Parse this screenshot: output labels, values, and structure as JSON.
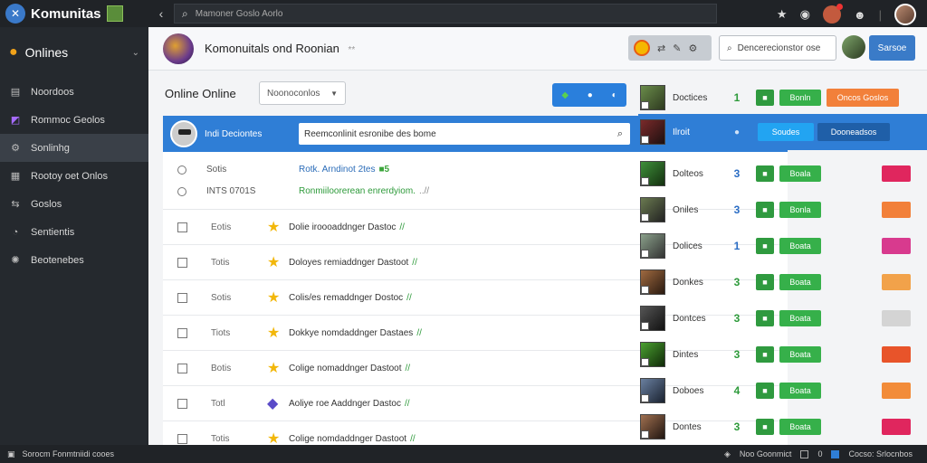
{
  "app": {
    "name": "Komunitas",
    "search_placeholder": "Mamoner Goslo Aorlo"
  },
  "sidebar": {
    "header": "Onlines",
    "items": [
      {
        "icon": "list-icon",
        "label": "Noordoos"
      },
      {
        "icon": "puzzle-icon",
        "label": "Rommoc Geolos"
      },
      {
        "icon": "gear-icon",
        "label": "Sonlinhg"
      },
      {
        "icon": "table-icon",
        "label": "Rootoy oet Onlos"
      },
      {
        "icon": "share-icon",
        "label": "Goslos"
      },
      {
        "icon": "chat-icon",
        "label": "Sentientis"
      },
      {
        "icon": "settings-icon",
        "label": "Beotenebes"
      }
    ]
  },
  "header": {
    "title": "Komonuitals ond Roonian",
    "subtitle": "**",
    "search_placeholder": "Dencerecionstor ose",
    "button": "Sarsoe"
  },
  "section": {
    "title": "Online Online",
    "filter": "Noonoconlos",
    "toggle_icons": [
      "◆",
      "●",
      "◐"
    ]
  },
  "table": {
    "header_label": "Indi Deciontes",
    "header_search": "Reemconlinit esronibe des bome",
    "radio_rows": [
      {
        "label": "Sotis",
        "text": "Rotk. Arndinot 2tes",
        "badge": "■5",
        "color": "blue"
      },
      {
        "label": "INTS 0701S",
        "text": "Ronmiiloorerean enrerdyiom.",
        "badge": "..//",
        "color": "green"
      }
    ],
    "rows": [
      {
        "label": "Eotis",
        "text": "Dolie iroooaddnger Dastoc",
        "mark": "//",
        "icon": "star-icon"
      },
      {
        "label": "Totis",
        "text": "Doloyes remiaddnger Dastoot",
        "mark": "//",
        "icon": "star-icon"
      },
      {
        "label": "Sotis",
        "text": "Colis/es remaddnger Dostoc",
        "mark": "//",
        "icon": "star-icon"
      },
      {
        "label": "Tiots",
        "text": "Dokkye nomdaddnger Dastaes",
        "mark": "//",
        "icon": "star-icon"
      },
      {
        "label": "Botis",
        "text": "Colige nomaddnger Dastoot",
        "mark": "//",
        "icon": "star-icon"
      },
      {
        "label": "Totl",
        "text": "Aoliye roe Aaddnger Dastoc",
        "mark": "//",
        "icon": "gem-icon"
      },
      {
        "label": "Totis",
        "text": "Colige nomdaddnger Dastoot",
        "mark": "//",
        "icon": "star-icon"
      }
    ]
  },
  "right_panel": {
    "top": {
      "label": "Doctices",
      "num": "1",
      "badge": "■",
      "btn": "Bonln",
      "btn2": "Oncos Goslos"
    },
    "highlight": {
      "label": "Ilroit",
      "btn1": "Soudes",
      "btn2": "Dooneadsos"
    },
    "rows": [
      {
        "label": "Dolteos",
        "num": "3",
        "badge": "■",
        "btn": "Boala",
        "color": "#e0265e"
      },
      {
        "label": "Oniles",
        "num": "3",
        "badge": "■",
        "btn": "Bonla",
        "color": "#f2803a"
      },
      {
        "label": "Dolices",
        "num": "1",
        "badge": "■",
        "btn": "Boata",
        "color": "#d83a8e"
      },
      {
        "label": "Donkes",
        "num": "3",
        "badge": "■",
        "btn": "Boata",
        "color": "#f2a24a"
      },
      {
        "label": "Dontces",
        "num": "3",
        "badge": "■",
        "btn": "Boata",
        "color": "#d4d4d4"
      },
      {
        "label": "Dintes",
        "num": "3",
        "badge": "■",
        "btn": "Boata",
        "color": "#e8542a"
      },
      {
        "label": "Doboes",
        "num": "4",
        "badge": "■",
        "btn": "Boata",
        "color": "#f28c3a"
      },
      {
        "label": "Dontes",
        "num": "3",
        "badge": "■",
        "btn": "Boata",
        "color": "#e0265e"
      }
    ]
  },
  "status": {
    "left": "Sorocm Fonmtniidi cooes",
    "right": [
      "Noo Goonmict",
      "0",
      "Cocso: Srlocnbos"
    ]
  },
  "colors": {
    "primary": "#2f7ed6",
    "sidebar": "#25292e",
    "green": "#36b04a",
    "orange": "#f2803a"
  }
}
